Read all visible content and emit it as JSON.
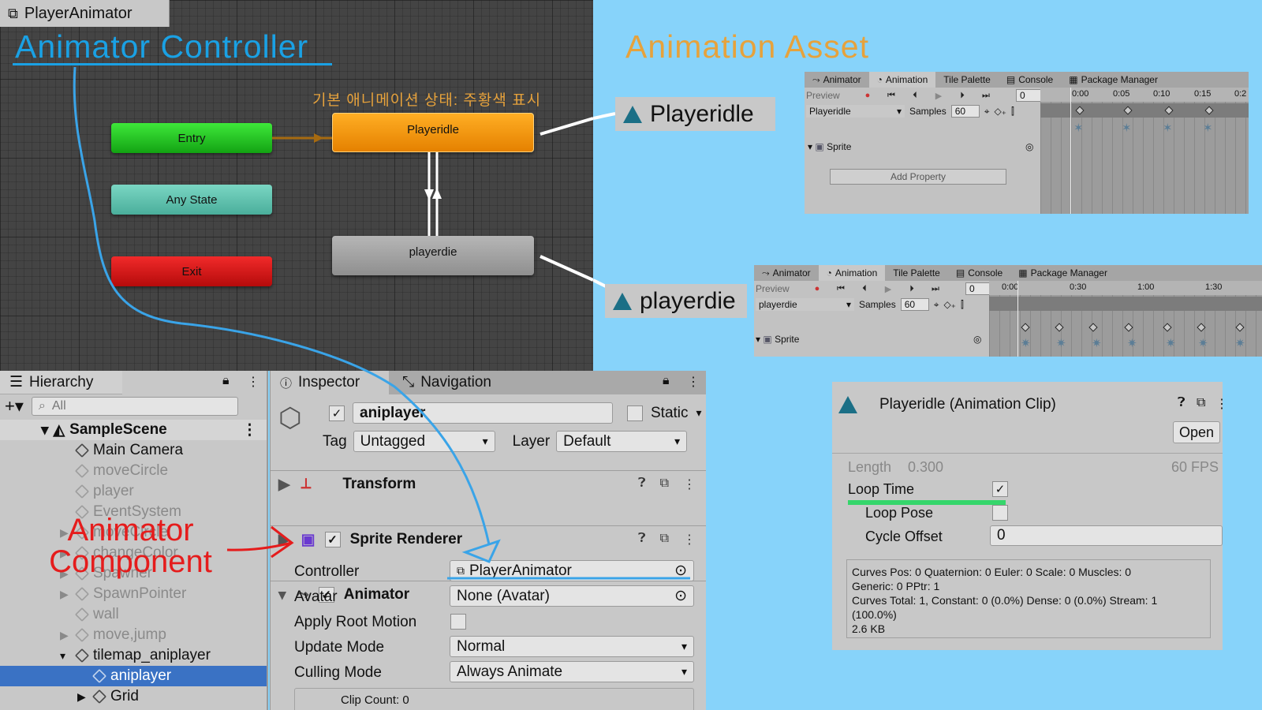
{
  "graph": {
    "tab_title": "PlayerAnimator",
    "annotation_title": "Animator Controller",
    "default_state_note": "기본 애니메이션 상태: 주황색 표시",
    "nodes": {
      "entry": "Entry",
      "any_state": "Any State",
      "exit": "Exit",
      "idle": "Playeridle",
      "die": "playerdie"
    },
    "colors": {
      "entry": "#2ed42a",
      "any_state": "#63c6b2",
      "exit": "#d81818",
      "default_state": "#f39a12",
      "state": "#a4a4a4",
      "annotation_blue": "#1aa1e4",
      "annotation_orange": "#e6a23c"
    }
  },
  "asset": {
    "title": "Animation Asset",
    "idle_label": "Playeridle",
    "die_label": "playerdie"
  },
  "anim_panel_1": {
    "tabs": [
      "Animator",
      "Animation",
      "Tile Palette",
      "Console",
      "Package Manager"
    ],
    "preview": "Preview",
    "frame": "0",
    "clip": "Playeridle",
    "samples_label": "Samples",
    "samples": "60",
    "property": "Sprite",
    "add_property": "Add Property",
    "ruler": [
      "0:00",
      "0:05",
      "0:10",
      "0:15",
      "0:2"
    ]
  },
  "anim_panel_2": {
    "tabs": [
      "Animator",
      "Animation",
      "Tile Palette",
      "Console",
      "Package Manager"
    ],
    "preview": "Preview",
    "frame": "0",
    "clip": "playerdie",
    "samples_label": "Samples",
    "samples": "60",
    "property": "Sprite",
    "ruler": [
      "0:00",
      "0:30",
      "1:00",
      "1:30"
    ]
  },
  "hierarchy": {
    "tab": "Hierarchy",
    "search_placeholder": "All",
    "scene": "SampleScene",
    "items": [
      {
        "label": "Main Camera",
        "dim": false,
        "indent": 2,
        "expander": false
      },
      {
        "label": "moveCircle",
        "dim": true,
        "indent": 2,
        "expander": false
      },
      {
        "label": "player",
        "dim": true,
        "indent": 2,
        "expander": false
      },
      {
        "label": "EventSystem",
        "dim": true,
        "indent": 2,
        "expander": false
      },
      {
        "label": "moveCircle",
        "dim": true,
        "indent": 2,
        "expander": true
      },
      {
        "label": "changeColor",
        "dim": true,
        "indent": 2,
        "expander": true
      },
      {
        "label": "Spawner",
        "dim": true,
        "indent": 2,
        "expander": true
      },
      {
        "label": "SpawnPointer",
        "dim": true,
        "indent": 2,
        "expander": true
      },
      {
        "label": "wall",
        "dim": true,
        "indent": 2,
        "expander": false
      },
      {
        "label": "move,jump",
        "dim": true,
        "indent": 2,
        "expander": true
      },
      {
        "label": "tilemap_aniplayer",
        "dim": false,
        "indent": 2,
        "expander": true
      },
      {
        "label": "aniplayer",
        "dim": false,
        "indent": 3,
        "expander": false,
        "selected": true
      },
      {
        "label": "Grid",
        "dim": false,
        "indent": 3,
        "expander": true
      }
    ]
  },
  "inspector": {
    "tab": "Inspector",
    "tab2": "Navigation",
    "object_name": "aniplayer",
    "static_label": "Static",
    "tag_label": "Tag",
    "tag_value": "Untagged",
    "layer_label": "Layer",
    "layer_value": "Default",
    "components": [
      "Transform",
      "Sprite Renderer",
      "Animator"
    ],
    "props": {
      "controller_label": "Controller",
      "controller_value": "PlayerAnimator",
      "avatar_label": "Avatar",
      "avatar_value": "None (Avatar)",
      "root_motion_label": "Apply Root Motion",
      "update_mode_label": "Update Mode",
      "update_mode_value": "Normal",
      "culling_label": "Culling Mode",
      "culling_value": "Always Animate",
      "clip_count": "Clip Count: 0"
    }
  },
  "annotation_component": {
    "line1": "Animator",
    "line2": "Component"
  },
  "clip": {
    "title": "Playeridle (Animation Clip)",
    "open_button": "Open",
    "length_label": "Length",
    "length_value": "0.300",
    "fps": "60 FPS",
    "loop_time_label": "Loop Time",
    "loop_time_checked": true,
    "loop_pose_label": "Loop Pose",
    "cycle_offset_label": "Cycle Offset",
    "cycle_offset_value": "0",
    "info_lines": [
      "Curves Pos: 0 Quaternion: 0 Euler: 0 Scale: 0 Muscles: 0",
      "Generic: 0 PPtr: 1",
      "Curves Total: 1, Constant: 0 (0.0%) Dense: 0 (0.0%) Stream: 1",
      "(100.0%)",
      "2.6 KB"
    ]
  }
}
